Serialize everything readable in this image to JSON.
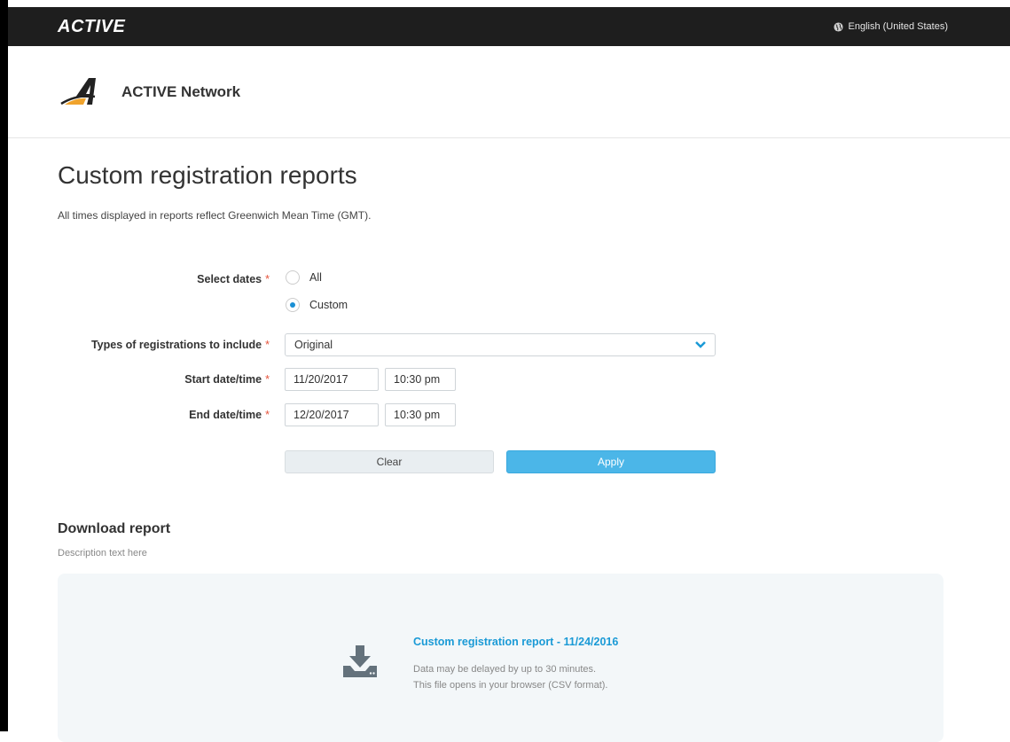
{
  "topbar": {
    "logo_text": "ACTIVE",
    "language": "English (United States)"
  },
  "brand": {
    "name": "ACTIVE Network"
  },
  "page": {
    "title": "Custom registration reports",
    "subtitle": "All times displayed in reports reflect Greenwich Mean Time (GMT)."
  },
  "form": {
    "select_dates_label": "Select dates",
    "date_options": [
      "All",
      "Custom"
    ],
    "selected_date_option": "Custom",
    "types_label": "Types of registrations to include",
    "types_value": "Original",
    "start_label": "Start date/time",
    "start_date": "11/20/2017",
    "start_time": "10:30 pm",
    "end_label": "End date/time",
    "end_date": "12/20/2017",
    "end_time": "10:30 pm",
    "required_mark": "*",
    "clear_label": "Clear",
    "apply_label": "Apply"
  },
  "download": {
    "title": "Download report",
    "description": "Description text here",
    "report_link": "Custom registration report - 11/24/2016",
    "note_1": "Data may be delayed by up to 30 minutes.",
    "note_2": "This file opens in your browser (CSV format).",
    "icon": "download-icon"
  },
  "colors": {
    "accent": "#1a9ad6",
    "apply_button": "#4bb6e8",
    "required": "#e5533b",
    "topbar": "#1e1e1e"
  }
}
